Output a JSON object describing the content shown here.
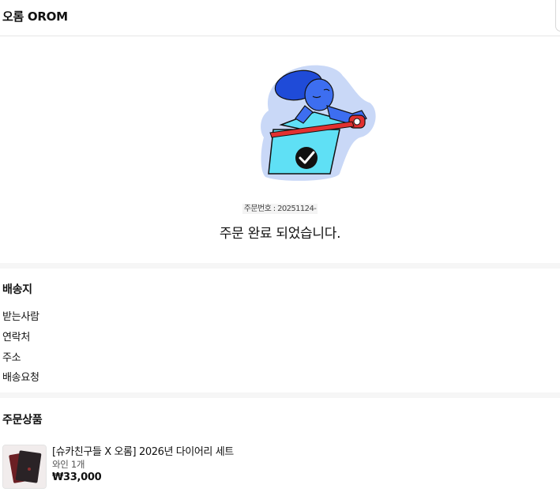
{
  "header": {
    "brand": "오롬 OROM"
  },
  "completion": {
    "order_number": "주문번호 : 20251124-",
    "message": "주문 완료 되었습니다."
  },
  "shipping": {
    "title": "배송지",
    "fields": [
      "받는사람",
      "연락처",
      "주소",
      "배송요청"
    ]
  },
  "products": {
    "title": "주문상품",
    "items": [
      {
        "name": "[슈카친구들 X 오롬] 2026년 다이어리 세트",
        "option": "와인 1개",
        "price": "₩33,000"
      }
    ]
  },
  "colors": {
    "illustration_blue": "#1f4bd8",
    "illustration_cyan": "#5fe0f5",
    "illustration_red": "#e23030",
    "sticker_bg": "#c9d8f7"
  },
  "icons": [
    "box-check-illustration"
  ]
}
